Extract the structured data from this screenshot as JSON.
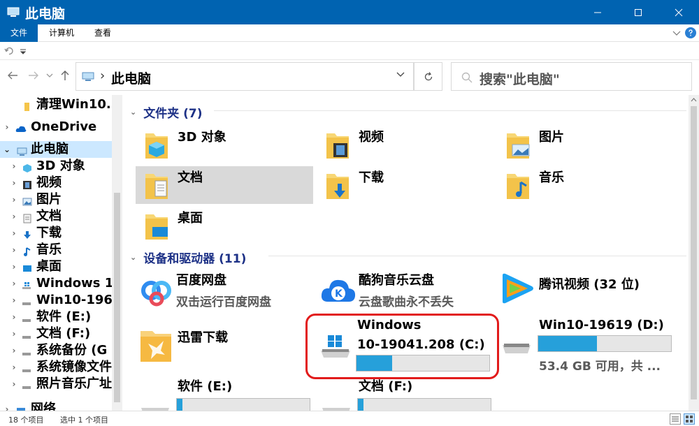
{
  "window": {
    "title": "此电脑",
    "title_color": "#0063b1",
    "accent": "#26a0da"
  },
  "ribbon": {
    "tabs": [
      "文件",
      "计算机",
      "查看"
    ]
  },
  "address": {
    "path": "此电脑",
    "separator": "›"
  },
  "search": {
    "placeholder": "搜索\"此电脑\""
  },
  "nav_pane": {
    "items": [
      {
        "label": "清理Win10...",
        "icon": "folder-icon"
      },
      {
        "label": "OneDrive",
        "icon": "cloud-icon"
      },
      {
        "label": "此电脑",
        "icon": "computer-icon"
      },
      {
        "label": "3D 对象",
        "icon": "cube-icon"
      },
      {
        "label": "视频",
        "icon": "video-icon"
      },
      {
        "label": "图片",
        "icon": "picture-icon"
      },
      {
        "label": "文档",
        "icon": "document-icon"
      },
      {
        "label": "下载",
        "icon": "download-icon"
      },
      {
        "label": "音乐",
        "icon": "music-icon"
      },
      {
        "label": "桌面",
        "icon": "desktop-icon"
      },
      {
        "label": "Windows 1",
        "icon": "windows-drive-icon"
      },
      {
        "label": "Win10-196",
        "icon": "drive-icon"
      },
      {
        "label": "软件 (E:)",
        "icon": "drive-icon"
      },
      {
        "label": "文档 (F:)",
        "icon": "drive-icon"
      },
      {
        "label": "系统备份 (G",
        "icon": "drive-icon"
      },
      {
        "label": "系统镜像文件",
        "icon": "drive-icon"
      },
      {
        "label": "照片音乐广址",
        "icon": "drive-icon"
      },
      {
        "label": "网络",
        "icon": "network-icon"
      }
    ]
  },
  "folders": {
    "header": "文件夹 (7)",
    "items": [
      {
        "name": "3D 对象",
        "icon": "cube-folder-icon"
      },
      {
        "name": "视频",
        "icon": "video-folder-icon"
      },
      {
        "name": "图片",
        "icon": "picture-folder-icon"
      },
      {
        "name": "文档",
        "icon": "document-folder-icon"
      },
      {
        "name": "下载",
        "icon": "download-folder-icon"
      },
      {
        "name": "音乐",
        "icon": "music-folder-icon"
      },
      {
        "name": "桌面",
        "icon": "desktop-folder-icon"
      }
    ]
  },
  "devices": {
    "header": "设备和驱动器 (11)",
    "items": [
      {
        "name": "百度网盘",
        "sub": "双击运行百度网盘",
        "icon": "baidu-netdisk-icon"
      },
      {
        "name": "酷狗音乐云盘",
        "sub": "云盘歌曲永不丢失",
        "icon": "kugou-icon"
      },
      {
        "name": "腾讯视频 (32 位)",
        "sub": "",
        "icon": "tencent-video-icon"
      },
      {
        "name": "迅雷下载",
        "sub": "",
        "icon": "xunlei-icon"
      },
      {
        "name": "Windows 10-19041.208 (C:)",
        "line1": "Windows",
        "line2": "10-19041.208 (C:)",
        "used_fraction": 0.27,
        "icon": "windows-drive-icon"
      },
      {
        "name": "Win10-19619 (D:)",
        "sub": "53.4 GB 可用，共 ...",
        "used_fraction": 0.44,
        "icon": "drive-icon"
      },
      {
        "name": "软件 (E:)",
        "used_fraction": 0.04,
        "icon": "drive-icon"
      },
      {
        "name": "文档 (F:)",
        "used_fraction": 0.04,
        "icon": "drive-icon"
      }
    ]
  },
  "status": {
    "count": "18 个项目",
    "selected": "选中 1 个项目"
  }
}
